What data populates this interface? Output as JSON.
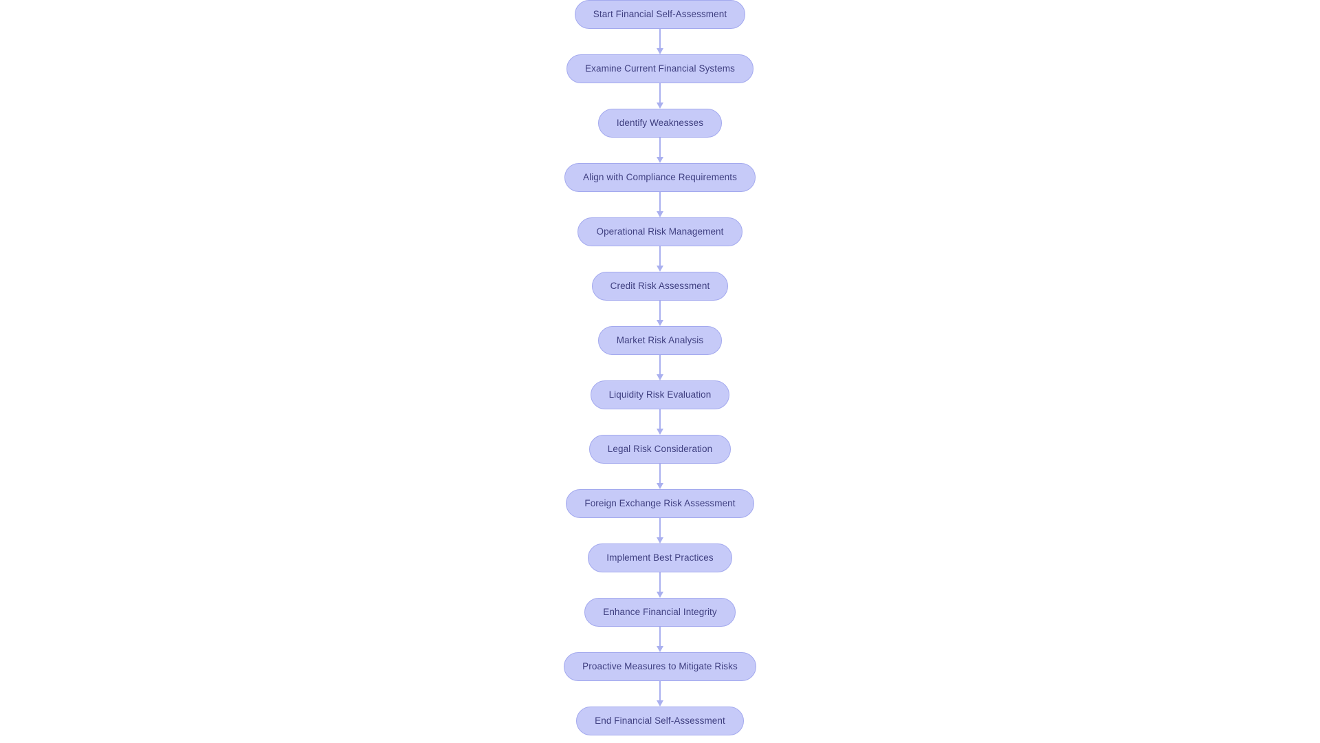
{
  "diagram": {
    "type": "flowchart",
    "orientation": "top-to-bottom",
    "background_color": "#ffffff",
    "node_fill_color": "#c6caf8",
    "node_border_color": "#a3a9ee",
    "node_text_color": "#3f3f80",
    "connector_color": "#aab0ef",
    "nodes": [
      {
        "id": "start",
        "label": "Start Financial Self-Assessment",
        "shape": "stadium"
      },
      {
        "id": "examine",
        "label": "Examine Current Financial Systems",
        "shape": "stadium"
      },
      {
        "id": "identify",
        "label": "Identify Weaknesses",
        "shape": "stadium"
      },
      {
        "id": "align",
        "label": "Align with Compliance Requirements",
        "shape": "stadium"
      },
      {
        "id": "operational",
        "label": "Operational Risk Management",
        "shape": "stadium"
      },
      {
        "id": "credit",
        "label": "Credit Risk Assessment",
        "shape": "stadium"
      },
      {
        "id": "market",
        "label": "Market Risk Analysis",
        "shape": "stadium"
      },
      {
        "id": "liquidity",
        "label": "Liquidity Risk Evaluation",
        "shape": "stadium"
      },
      {
        "id": "legal",
        "label": "Legal Risk Consideration",
        "shape": "stadium"
      },
      {
        "id": "forex",
        "label": "Foreign Exchange Risk Assessment",
        "shape": "stadium"
      },
      {
        "id": "implement",
        "label": "Implement Best Practices",
        "shape": "stadium"
      },
      {
        "id": "enhance",
        "label": "Enhance Financial Integrity",
        "shape": "stadium"
      },
      {
        "id": "proactive",
        "label": "Proactive Measures to Mitigate Risks",
        "shape": "stadium"
      },
      {
        "id": "end",
        "label": "End Financial Self-Assessment",
        "shape": "stadium"
      }
    ],
    "edges": [
      {
        "from": "start",
        "to": "examine",
        "label": ""
      },
      {
        "from": "examine",
        "to": "identify",
        "label": ""
      },
      {
        "from": "identify",
        "to": "align",
        "label": ""
      },
      {
        "from": "align",
        "to": "operational",
        "label": ""
      },
      {
        "from": "operational",
        "to": "credit",
        "label": ""
      },
      {
        "from": "credit",
        "to": "market",
        "label": ""
      },
      {
        "from": "market",
        "to": "liquidity",
        "label": ""
      },
      {
        "from": "liquidity",
        "to": "legal",
        "label": ""
      },
      {
        "from": "legal",
        "to": "forex",
        "label": ""
      },
      {
        "from": "forex",
        "to": "implement",
        "label": ""
      },
      {
        "from": "implement",
        "to": "enhance",
        "label": ""
      },
      {
        "from": "enhance",
        "to": "proactive",
        "label": ""
      },
      {
        "from": "proactive",
        "to": "end",
        "label": ""
      }
    ]
  }
}
